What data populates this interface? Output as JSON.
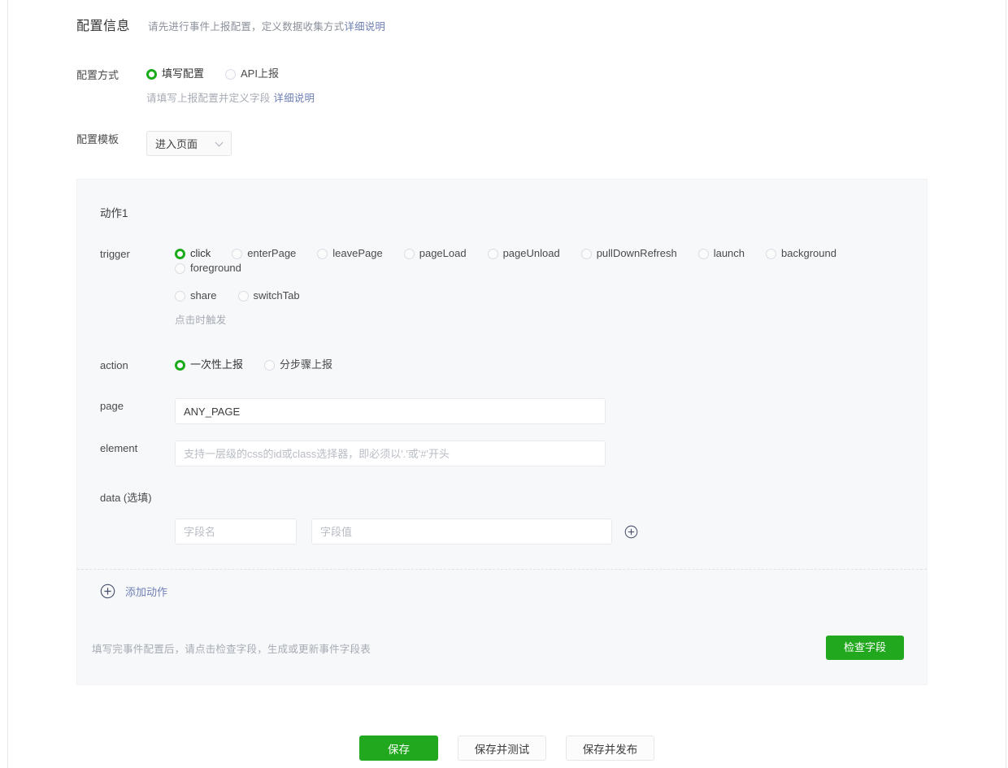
{
  "header": {
    "title": "配置信息",
    "desc": "请先进行事件上报配置，定义数据收集方式",
    "desc_link": "详细说明"
  },
  "config_mode": {
    "label": "配置方式",
    "options": [
      {
        "label": "填写配置",
        "checked": true
      },
      {
        "label": "API上报",
        "checked": false
      }
    ],
    "hint": "请填写上报配置并定义字段",
    "hint_link": "详细说明"
  },
  "config_template": {
    "label": "配置模板",
    "selected": "进入页面",
    "options": [
      "进入页面"
    ]
  },
  "action_panel": {
    "title": "动作1",
    "trigger": {
      "label": "trigger",
      "options": [
        {
          "label": "click",
          "checked": true
        },
        {
          "label": "enterPage",
          "checked": false
        },
        {
          "label": "leavePage",
          "checked": false
        },
        {
          "label": "pageLoad",
          "checked": false
        },
        {
          "label": "pageUnload",
          "checked": false
        },
        {
          "label": "pullDownRefresh",
          "checked": false
        },
        {
          "label": "launch",
          "checked": false
        },
        {
          "label": "background",
          "checked": false
        },
        {
          "label": "foreground",
          "checked": false
        }
      ],
      "options_line2": [
        {
          "label": "share",
          "checked": false
        },
        {
          "label": "switchTab",
          "checked": false
        }
      ],
      "hint": "点击时触发"
    },
    "action": {
      "label": "action",
      "options": [
        {
          "label": "一次性上报",
          "checked": true
        },
        {
          "label": "分步骤上报",
          "checked": false
        }
      ]
    },
    "page": {
      "label": "page",
      "value": "ANY_PAGE",
      "placeholder": ""
    },
    "element": {
      "label": "element",
      "value": "",
      "placeholder": "支持一层级的css的id或class选择器，即必须以'.'或'#'开头"
    },
    "data": {
      "label": "data (选填)",
      "field_name_placeholder": "字段名",
      "field_value_placeholder": "字段值",
      "field_name_value": "",
      "field_value_value": "",
      "add_field_icon": "plus-circle-icon"
    },
    "add_action": {
      "icon": "plus-circle-icon",
      "label": "添加动作"
    },
    "footer": {
      "hint": "填写完事件配置后，请点击检查字段，生成或更新事件字段表",
      "check_button": "检查字段"
    }
  },
  "bottom_bar": {
    "save": "保存",
    "save_and_test": "保存并测试",
    "save_and_publish": "保存并发布"
  },
  "colors": {
    "accent_green": "#22a81e",
    "link_blue": "#6f7fb5",
    "panel_bg": "#f7f8fa",
    "muted_text": "#a6abb3"
  }
}
